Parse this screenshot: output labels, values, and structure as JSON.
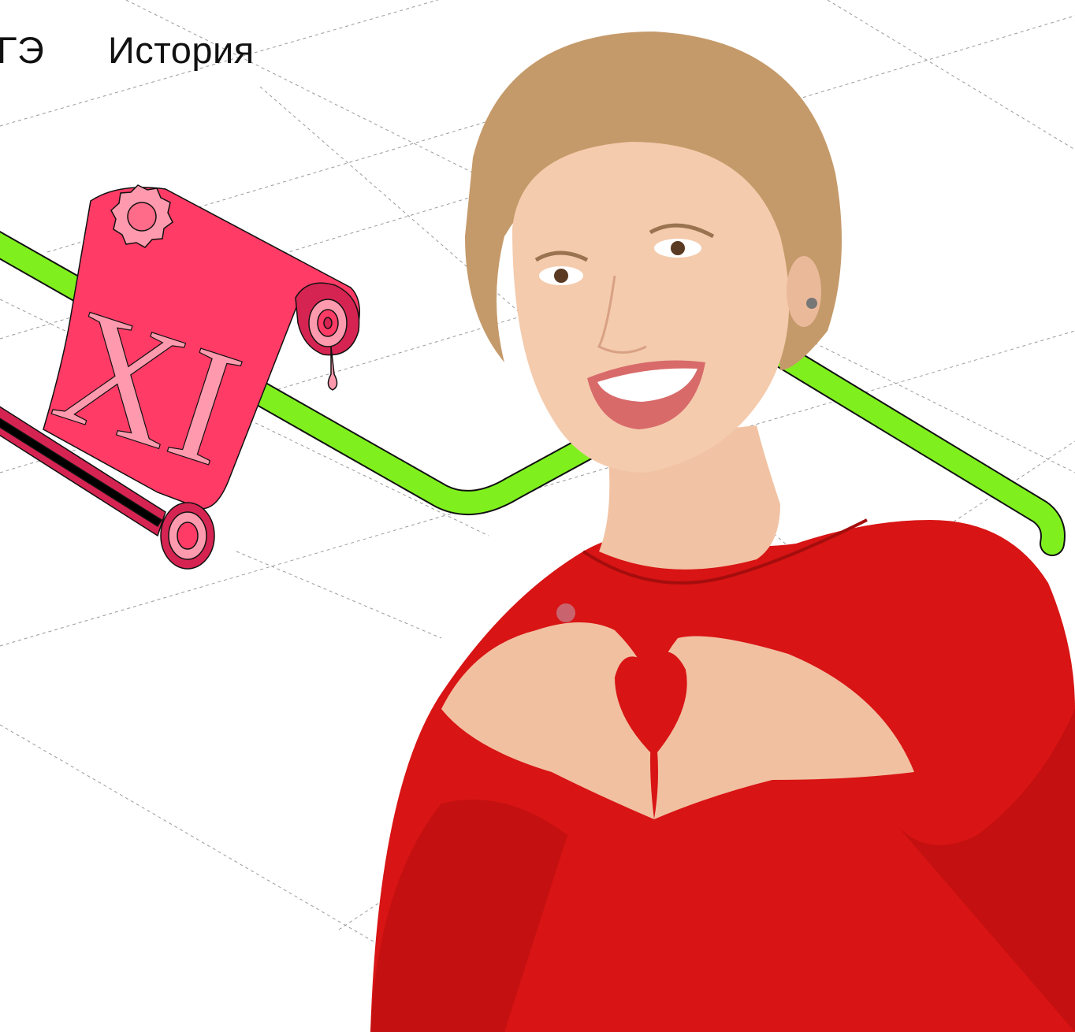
{
  "header": {
    "nav_fragment": "ГЭ",
    "subject_title": "История"
  },
  "illustration": {
    "scroll_numeral": "XI",
    "icons": [
      "scroll-icon",
      "wax-seal-icon",
      "path-line-icon"
    ]
  },
  "colors": {
    "accent_green": "#7FF01E",
    "scroll_pink": "#FF3B66",
    "scroll_light": "#FF9AAE",
    "sweater_red": "#D81414",
    "background": "#FFFFFF",
    "text": "#111111"
  },
  "photo": {
    "description_icon": "person-photo"
  }
}
